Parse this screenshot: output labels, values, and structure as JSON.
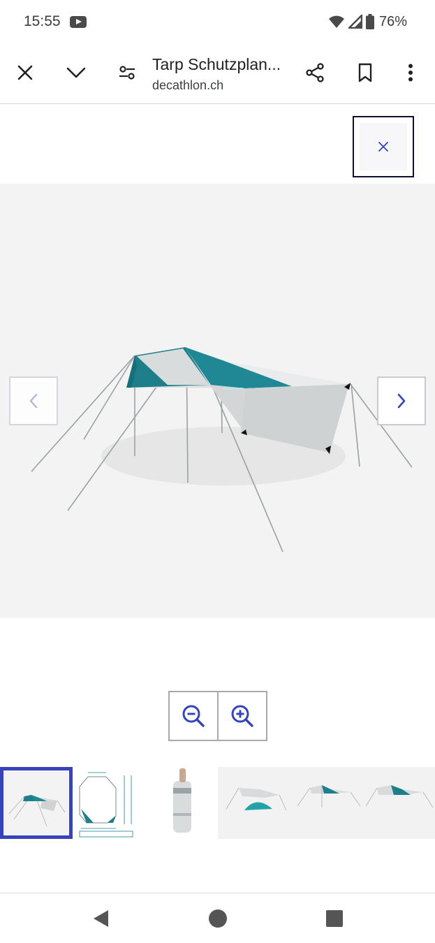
{
  "status": {
    "time": "15:55",
    "battery": "76%",
    "icons": [
      "youtube-icon",
      "wifi-icon",
      "cell-signal-icon",
      "battery-icon"
    ]
  },
  "toolbar": {
    "title": "Tarp Schutzplan...",
    "domain": "decathlon.ch",
    "icons": [
      "close-icon",
      "chevron-down-icon",
      "page-settings-icon",
      "share-icon",
      "bookmark-icon",
      "more-vert-icon"
    ]
  },
  "gallery": {
    "close_icon": "close-icon",
    "prev_icon": "chevron-left-icon",
    "next_icon": "chevron-right-icon",
    "zoom_out_icon": "zoom-out-icon",
    "zoom_in_icon": "zoom-in-icon",
    "thumbnails": [
      "tarp-product",
      "tarp-dimensions",
      "packed-bag",
      "tarp-with-tent",
      "tarp-pitched",
      "tarp-pitched-alt"
    ],
    "active_thumbnail": 1
  },
  "colors": {
    "accent": "#3643ba",
    "tarp_teal": "#1e7f8a",
    "tarp_grey": "#d8dadb"
  },
  "system_nav": [
    "back-icon",
    "home-icon",
    "recents-icon"
  ]
}
